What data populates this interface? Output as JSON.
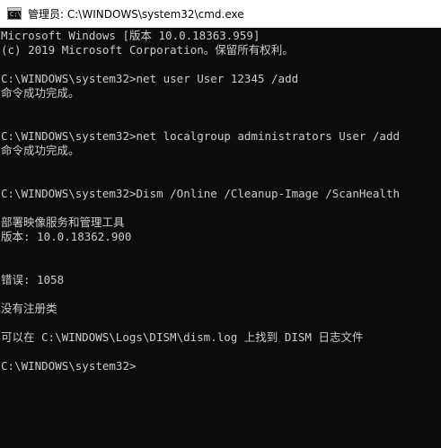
{
  "window": {
    "title": "管理员: C:\\WINDOWS\\system32\\cmd.exe",
    "icon_name": "cmd-icon",
    "icon_glyph": "C:\\"
  },
  "console": {
    "text_color": "#cccccc",
    "background_color": "#0c0c0c",
    "lines": [
      "Microsoft Windows [版本 10.0.18363.959]",
      "(c) 2019 Microsoft Corporation。保留所有权利。",
      "C:\\WINDOWS\\system32>net user User 12345 /add",
      "命令成功完成。",
      "C:\\WINDOWS\\system32>net localgroup administrators User /add",
      "命令成功完成。",
      "C:\\WINDOWS\\system32>Dism /Online /Cleanup-Image /ScanHealth",
      "部署映像服务和管理工具",
      "版本: 10.0.18362.900",
      "错误: 1058",
      "没有注册类",
      "可以在 C:\\WINDOWS\\Logs\\DISM\\dism.log 上找到 DISM 日志文件",
      "C:\\WINDOWS\\system32>"
    ]
  }
}
